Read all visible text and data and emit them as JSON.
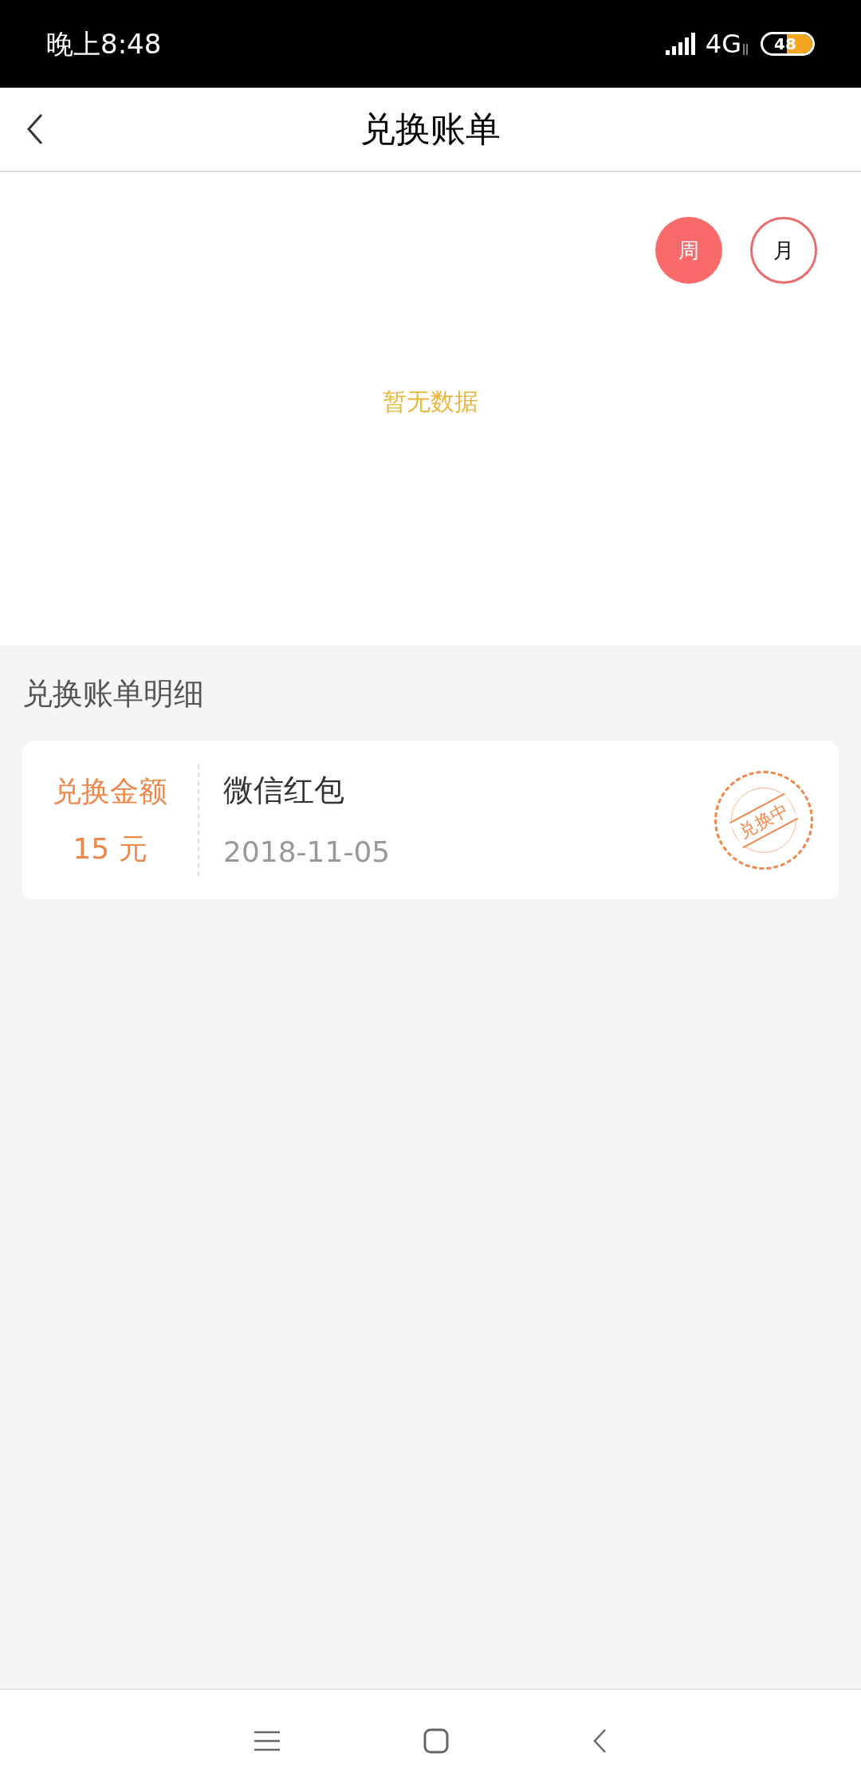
{
  "status_bar": {
    "time": "晚上8:48",
    "network": "4G",
    "battery": "48"
  },
  "header": {
    "title": "兑换账单"
  },
  "period_tabs": [
    {
      "label": "周",
      "selected": true
    },
    {
      "label": "月",
      "selected": false
    }
  ],
  "chart": {
    "empty_text": "暂无数据"
  },
  "details": {
    "title": "兑换账单明细",
    "records": [
      {
        "amount_label": "兑换金额",
        "amount": "15 元",
        "name": "微信红包",
        "date": "2018-11-05",
        "stamp": "兑换中"
      }
    ]
  }
}
